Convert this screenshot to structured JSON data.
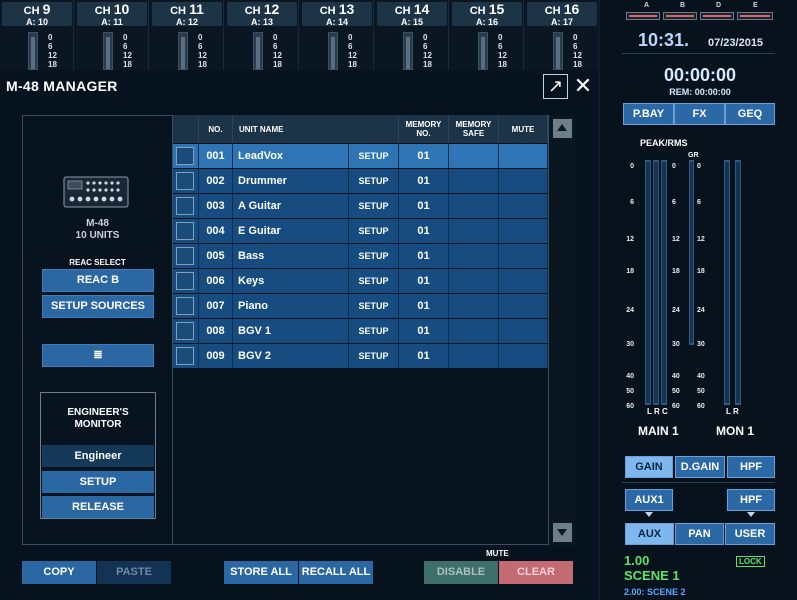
{
  "channels": [
    {
      "prefix": "CH ",
      "num": "9",
      "assign": "A: 10"
    },
    {
      "prefix": "CH ",
      "num": "10",
      "assign": "A: 11"
    },
    {
      "prefix": "CH ",
      "num": "11",
      "assign": "A: 12"
    },
    {
      "prefix": "CH ",
      "num": "12",
      "assign": "A: 13"
    },
    {
      "prefix": "CH ",
      "num": "13",
      "assign": "A: 14"
    },
    {
      "prefix": "CH ",
      "num": "14",
      "assign": "A: 15"
    },
    {
      "prefix": "CH ",
      "num": "15",
      "assign": "A: 16"
    },
    {
      "prefix": "CH ",
      "num": "16",
      "assign": "A: 17"
    }
  ],
  "channel_scale": [
    "0",
    "6",
    "12",
    "18"
  ],
  "status": {
    "slots": [
      "A",
      "B",
      "D",
      "E"
    ],
    "time": "10:31.",
    "date": "07/23/2015",
    "recorder_time": "00:00:00",
    "remaining": "REM: 00:00:00"
  },
  "top_buttons": {
    "pbay": "P.BAY",
    "fx": "FX",
    "geq": "GEQ"
  },
  "meters": {
    "title": "PEAK/RMS",
    "gr": "GR",
    "scale": [
      "0",
      "6",
      "12",
      "18",
      "24",
      "30",
      "40",
      "50",
      "60"
    ],
    "main_foot": "L R C",
    "mon_foot": "L  R",
    "main_label": "MAIN 1",
    "mon_label": "MON 1"
  },
  "knob_buttons": {
    "gain": "GAIN",
    "dgain": "D.GAIN",
    "hpf": "HPF",
    "aux1": "AUX1",
    "hpf2": "HPF"
  },
  "mode_buttons": {
    "aux": "AUX",
    "pan": "PAN",
    "user": "USER"
  },
  "scene": {
    "number": "1.00",
    "name": "SCENE 1",
    "lock": "LOCK",
    "next": "2.00: SCENE 2"
  },
  "manager": {
    "title": "M-48 MANAGER",
    "popout": "↗",
    "close": "✕",
    "device_name": "M-48",
    "device_units": "10 UNITS",
    "reac_select_label": "REAC SELECT",
    "reac_button": "REAC B",
    "setup_sources": "SETUP SOURCES",
    "menu_icon": "≣",
    "engineer_title_1": "ENGINEER'S",
    "engineer_title_2": "MONITOR",
    "engineer_button": "Engineer",
    "setup_button": "SETUP",
    "release_button": "RELEASE",
    "columns": {
      "no": "NO.",
      "unit_name": "UNIT NAME",
      "memory_no_1": "MEMORY",
      "memory_no_2": "NO.",
      "memory_safe_1": "MEMORY",
      "memory_safe_2": "SAFE",
      "mute": "MUTE"
    },
    "setup_label": "SETUP",
    "units": [
      {
        "no": "001",
        "name": "LeadVox",
        "memory": "01",
        "selected": true
      },
      {
        "no": "002",
        "name": "Drummer",
        "memory": "01"
      },
      {
        "no": "003",
        "name": "A Guitar",
        "memory": "01"
      },
      {
        "no": "004",
        "name": "E Guitar",
        "memory": "01"
      },
      {
        "no": "005",
        "name": "Bass",
        "memory": "01"
      },
      {
        "no": "006",
        "name": "Keys",
        "memory": "01"
      },
      {
        "no": "007",
        "name": "Piano",
        "memory": "01"
      },
      {
        "no": "008",
        "name": "BGV 1",
        "memory": "01"
      },
      {
        "no": "009",
        "name": "BGV 2",
        "memory": "01"
      }
    ],
    "bottom": {
      "copy": "COPY",
      "paste": "PASTE",
      "store_all": "STORE ALL",
      "recall_all": "RECALL ALL",
      "mute_label": "MUTE",
      "disable": "DISABLE",
      "clear": "CLEAR"
    }
  },
  "colors": {
    "accent": "#2b67a3",
    "selected_row": "#2f75b6",
    "scene_green": "#5ce36a",
    "clear_red": "#c46a73"
  }
}
